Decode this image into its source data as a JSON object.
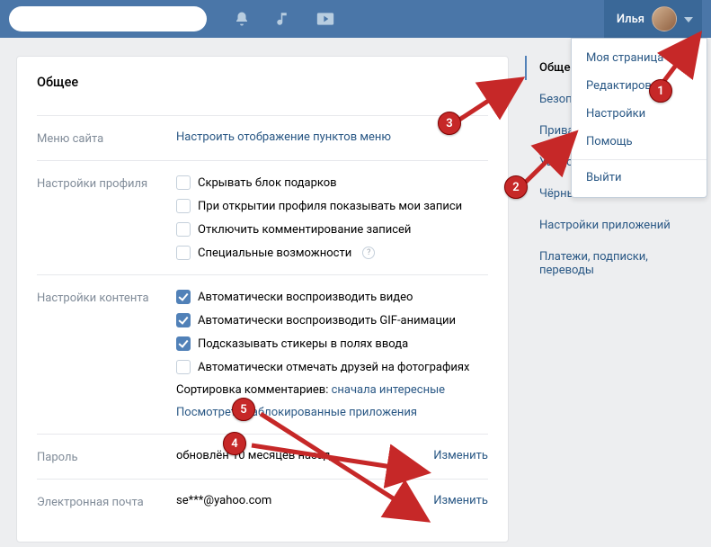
{
  "topbar": {
    "user_name": "Илья"
  },
  "dropdown": {
    "items": [
      "Моя страница",
      "Редактировать",
      "Настройки",
      "Помощь",
      "Выйти"
    ]
  },
  "page": {
    "title": "Общее"
  },
  "rows": {
    "menu_label": "Меню сайта",
    "menu_link": "Настроить отображение пунктов меню",
    "profile_label": "Настройки профиля",
    "profile_opts": [
      "Скрывать блок подарков",
      "При открытии профиля показывать мои записи",
      "Отключить комментирование записей",
      "Специальные возможности"
    ],
    "content_label": "Настройки контента",
    "content_opts": [
      "Автоматически воспроизводить видео",
      "Автоматически воспроизводить GIF-анимации",
      "Подсказывать стикеры в полях ввода",
      "Автоматически отмечать друзей на фотографиях"
    ],
    "sort_label": "Сортировка комментариев: ",
    "sort_value": "сначала интересные",
    "blocked_apps": "Посмотреть заблокированные приложения",
    "password_label": "Пароль",
    "password_value": "обновлён 10 месяцев назад",
    "change": "Изменить",
    "email_label": "Электронная почта",
    "email_value": "se***@yahoo.com"
  },
  "side": {
    "items": [
      "Общее",
      "Безопасность",
      "Приватность",
      "Уведомления",
      "Чёрный список",
      "Настройки приложений",
      "Платежи, подписки, переводы"
    ]
  },
  "annotations": [
    "1",
    "2",
    "3",
    "4",
    "5"
  ]
}
